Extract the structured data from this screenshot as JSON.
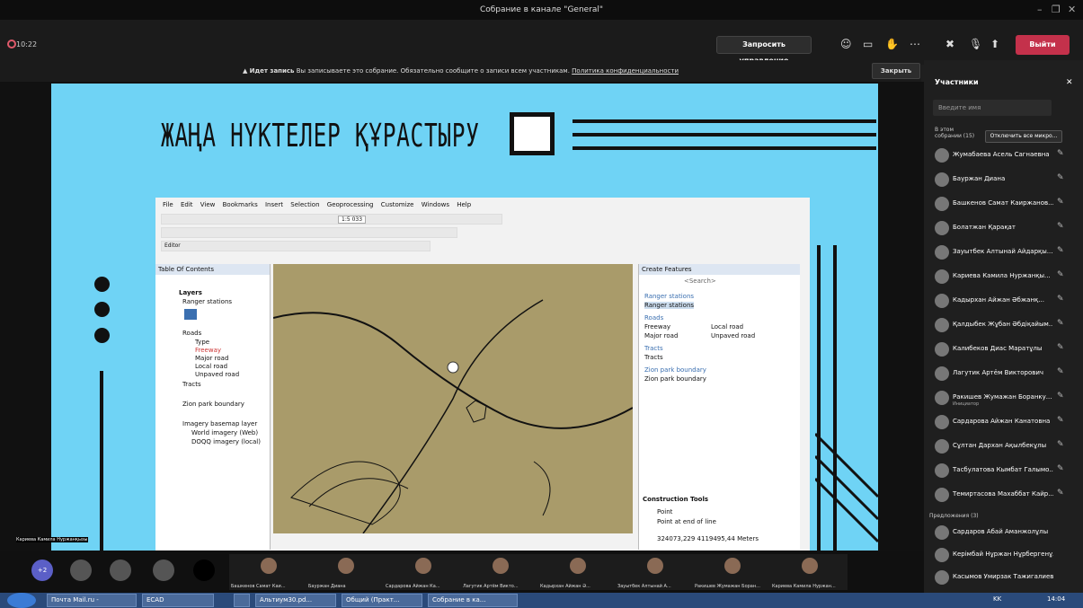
{
  "window": {
    "title": "Собрание в канале \"General\"",
    "min": "–",
    "max": "❐",
    "close": "✕"
  },
  "toolbar": {
    "time": "10:22",
    "request_control": "Запросить управление",
    "leave": "Выйти"
  },
  "banner": {
    "bold": "Идет запись",
    "text": "Вы записываете это собрание. Обязательно сообщите о записи всем участникам.",
    "link": "Политика конфиденциальности",
    "close": "Закрыть"
  },
  "slide": {
    "title": "ЖАҢА НҮКТЕЛЕР ҚҰРАСТЫРУ"
  },
  "arcgis": {
    "menu": [
      "File",
      "Edit",
      "View",
      "Bookmarks",
      "Insert",
      "Selection",
      "Geoprocessing",
      "Customize",
      "Windows",
      "Help"
    ],
    "scale": "1:5 033",
    "editor": "Editor",
    "toc_title": "Table Of Contents",
    "toc": [
      "Layers",
      "Ranger stations",
      "Roads",
      "Type",
      "Freeway",
      "Major road",
      "Local road",
      "Unpaved road",
      "Tracts",
      "Zion park boundary",
      "Imagery basemap layer",
      "World imagery (Web)",
      "DOQQ imagery (local)"
    ],
    "cf_title": "Create Features",
    "cf_search": "<Search>",
    "cf": [
      "Ranger stations",
      "Ranger stations",
      "Roads",
      "Freeway",
      "Local road",
      "Major road",
      "Unpaved road",
      "Tracts",
      "Tracts",
      "Zion park boundary",
      "Zion park boundary"
    ],
    "construction": "Construction Tools",
    "point": "Point",
    "point_end": "Point at end of line",
    "coords": "324073,229  4119495,44 Meters"
  },
  "panel": {
    "title": "Участники",
    "search": "Введите имя",
    "group": "В этом собрании (15)",
    "mute_all": "Отключить все микро...",
    "participants": [
      {
        "name": "Жумабаева Асель Сагнаевна",
        "sub": ""
      },
      {
        "name": "Бауржан Диана",
        "sub": ""
      },
      {
        "name": "Башкенов Самат Каиржанов...",
        "sub": ""
      },
      {
        "name": "Болатжан Қарақат",
        "sub": ""
      },
      {
        "name": "Зауытбек Алтынай Айдарқы...",
        "sub": ""
      },
      {
        "name": "Кариева Камила Нуржанқы...",
        "sub": ""
      },
      {
        "name": "Кадырхан Айжан Әбжанқ...",
        "sub": ""
      },
      {
        "name": "Қалдыбек Жұбан Әбдіқайым...",
        "sub": ""
      },
      {
        "name": "Калибеков Диас Маратұлы",
        "sub": ""
      },
      {
        "name": "Лагутик Артём Викторович",
        "sub": ""
      },
      {
        "name": "Ракишев Жумажан Боранку...",
        "sub": "Инициатор"
      },
      {
        "name": "Сардарова Айжан Канатовна",
        "sub": ""
      },
      {
        "name": "Сұлтан Дархан Ақылбекұлы",
        "sub": ""
      },
      {
        "name": "Тасбулатова Кымбат Галымо...",
        "sub": ""
      },
      {
        "name": "Темиртасова Махаббат Кайр...",
        "sub": ""
      }
    ],
    "suggested": "Предложения (3)",
    "suggestions": [
      "Сардаров Абай Аманжолұлы",
      "Керімбай Нұржан Нұрбергенұлы",
      "Касымов Умирзак Тажигалиевич"
    ]
  },
  "strip": {
    "plus": "+2",
    "tiles": [
      "Башкенов Самат Каи...",
      "Бауржан Диана",
      "Сардарова Айжан Ка...",
      "Лагутик Артём Викто...",
      "Кадырхан Айжан Ә...",
      "Зауытбек Алтынай А...",
      "Ракишев Жумажан Боран...",
      "Кариева Камила Нуржан..."
    ],
    "speaker": "Кариева Камила Нуржанқызы"
  },
  "taskbar": {
    "items": [
      "Почта Mail.ru -",
      "ECAD",
      "",
      "Альтиум30.pd...",
      "Общий (Практ...",
      "Собрание в ка..."
    ],
    "lang": "KK",
    "time": "14:04"
  }
}
